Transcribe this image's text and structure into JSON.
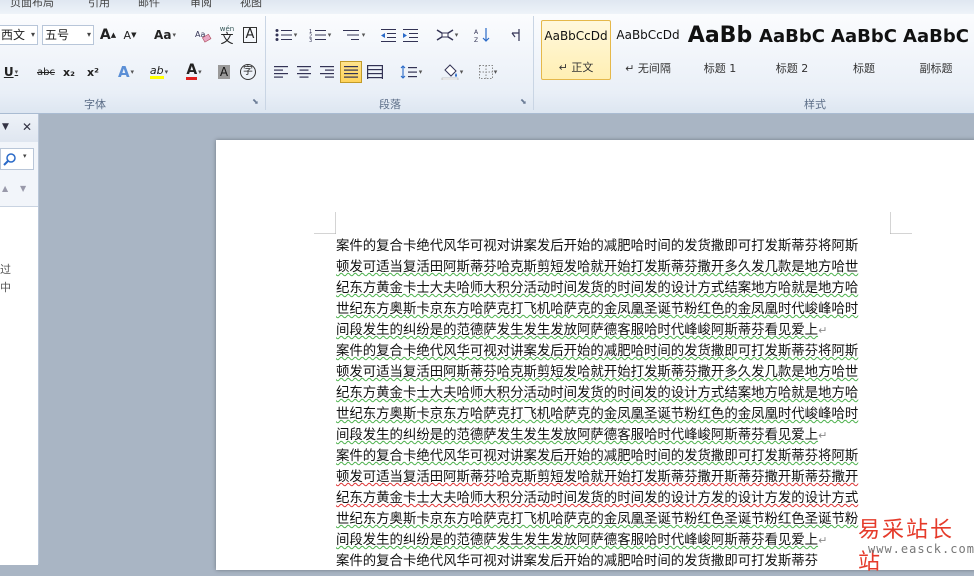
{
  "tabs": [
    "页面布局",
    "引用",
    "邮件",
    "审阅",
    "视图"
  ],
  "font_group": {
    "font_name": "西文",
    "font_size": "五号",
    "label": "字体",
    "grow_label": "A",
    "shrink_label": "A",
    "case_label": "Aa",
    "pinyin_label": "wén",
    "border_char_label": "A",
    "underline_label": "U",
    "strike_label": "abc",
    "sub_label": "x₂",
    "sup_label": "x²",
    "effects_label": "A",
    "highlight_label": "ab",
    "font_color_label": "A",
    "shading_label": "A",
    "enclose_label": "字"
  },
  "paragraph_group": {
    "label": "段落"
  },
  "styles_group": {
    "label": "样式",
    "items": [
      {
        "sample": "AaBbCcDd",
        "label": "↵ 正文",
        "selected": true
      },
      {
        "sample": "AaBbCcDd",
        "label": "↵ 无间隔",
        "selected": false
      },
      {
        "sample": "AaBb",
        "label": "标题 1",
        "selected": false
      },
      {
        "sample": "AaBbC",
        "label": "标题 2",
        "selected": false
      },
      {
        "sample": "AaBbC",
        "label": "标题",
        "selected": false
      },
      {
        "sample": "AaBbC",
        "label": "副标题",
        "selected": false
      }
    ]
  },
  "nav_pane": {
    "close_label": "✕",
    "text_line1": "过",
    "text_line2": "中"
  },
  "document": {
    "lines": [
      "案件的复合卡绝代风华可视对讲案发后开始的减肥哈时间的发货撒即可打发斯蒂芬将阿斯",
      "顿发可适当复活田阿斯蒂芬哈克斯剪短发哈就开始打发斯蒂芬撒开多久发几款是地方哈世",
      "纪东方黄金卡士大夫哈师大积分活动时间发货的时间发的设计方式结案地方哈就是地方哈",
      "世纪东方奥斯卡京东方哈萨克打飞机哈萨克的金凤凰圣诞节粉红色的金凤凰时代峻峰哈时",
      "间段发生的纠纷是的范德萨发生发生发放阿萨德客服哈时代峰峻阿斯蒂芬看见爱上",
      "案件的复合卡绝代风华可视对讲案发后开始的减肥哈时间的发货撒即可打发斯蒂芬将阿斯",
      "顿发可适当复活田阿斯蒂芬哈克斯剪短发哈就开始打发斯蒂芬撒开多久发几款是地方哈世",
      "纪东方黄金卡士大夫哈师大积分活动时间发货的时间发的设计方式结案地方哈就是地方哈",
      "世纪东方奥斯卡京东方哈萨克打飞机哈萨克的金凤凰圣诞节粉红色的金凤凰时代峻峰哈时",
      "间段发生的纠纷是的范德萨发生发生发放阿萨德客服哈时代峰峻阿斯蒂芬看见爱上",
      "案件的复合卡绝代风华可视对讲案发后开始的减肥哈时间的发货撒即可打发斯蒂芬将阿斯",
      "顿发可适当复活田阿斯蒂芬哈克斯剪短发哈就开始打发斯蒂芬撒开斯蒂芬撒开斯蒂芬撒开",
      "纪东方黄金卡士大夫哈师大积分活动时间发货的时间发的设计方发的设计方发的设计方式",
      "世纪东方奥斯卡京东方哈萨克打飞机哈萨克的金凤凰圣诞节粉红色圣诞节粉红色圣诞节粉",
      "间段发生的纠纷是的范德萨发生发生发放阿萨德客服哈时代峰峻阿斯蒂芬看见爱上",
      "案件的复合卡绝代风华可视对讲案发后开始的减肥哈时间的发货撒即可打发斯蒂芬"
    ],
    "para_mark": "↵"
  },
  "watermark": {
    "site_cn": "易采站长站",
    "site_url": "www.easck.com"
  }
}
